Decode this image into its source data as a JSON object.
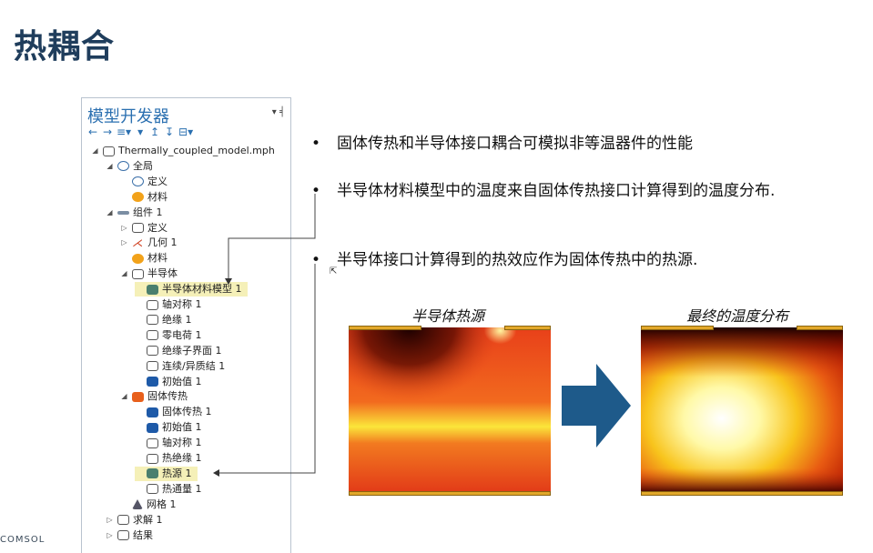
{
  "slide": {
    "title": "热耦合",
    "logo": "COMSOL"
  },
  "panel": {
    "header": "模型开发器",
    "header_controls": "▾ ╡",
    "toolbar": [
      "←",
      "→",
      "≡▾",
      "▾",
      "↥",
      "↧",
      "⊟▾"
    ]
  },
  "tree": [
    {
      "indent": 0,
      "exp": "◢",
      "icon": "model",
      "label": "Thermally_coupled_model.mph"
    },
    {
      "indent": 1,
      "exp": "◢",
      "icon": "globe",
      "label": "全局"
    },
    {
      "indent": 2,
      "exp": "",
      "icon": "def",
      "label": "定义"
    },
    {
      "indent": 2,
      "exp": "",
      "icon": "mat",
      "label": "材料"
    },
    {
      "indent": 1,
      "exp": "◢",
      "icon": "comp",
      "label": "组件 1"
    },
    {
      "indent": 2,
      "exp": "▷",
      "icon": "def-list",
      "label": "定义"
    },
    {
      "indent": 2,
      "exp": "▷",
      "icon": "geo",
      "label": "几何 1"
    },
    {
      "indent": 2,
      "exp": "",
      "icon": "mat",
      "label": "材料"
    },
    {
      "indent": 2,
      "exp": "◢",
      "icon": "semi",
      "label": "半导体"
    },
    {
      "indent": 3,
      "exp": "",
      "icon": "teal",
      "label": "半导体材料模型 1",
      "highlight": true
    },
    {
      "indent": 3,
      "exp": "",
      "icon": "outline",
      "label": "轴对称 1"
    },
    {
      "indent": 3,
      "exp": "",
      "icon": "outline",
      "label": "绝缘 1"
    },
    {
      "indent": 3,
      "exp": "",
      "icon": "outline",
      "label": "零电荷 1"
    },
    {
      "indent": 3,
      "exp": "",
      "icon": "outline",
      "label": "绝缘子界面 1"
    },
    {
      "indent": 3,
      "exp": "",
      "icon": "outline",
      "label": "连续/异质结 1"
    },
    {
      "indent": 3,
      "exp": "",
      "icon": "blue",
      "label": "初始值 1"
    },
    {
      "indent": 2,
      "exp": "◢",
      "icon": "heat",
      "label": "固体传热"
    },
    {
      "indent": 3,
      "exp": "",
      "icon": "blue",
      "label": "固体传热 1"
    },
    {
      "indent": 3,
      "exp": "",
      "icon": "blue",
      "label": "初始值 1"
    },
    {
      "indent": 3,
      "exp": "",
      "icon": "outline",
      "label": "轴对称 1"
    },
    {
      "indent": 3,
      "exp": "",
      "icon": "outline",
      "label": "热绝缘 1"
    },
    {
      "indent": 3,
      "exp": "",
      "icon": "teal",
      "label": "热源 1",
      "highlight": true
    },
    {
      "indent": 3,
      "exp": "",
      "icon": "outline",
      "label": "热通量 1"
    },
    {
      "indent": 2,
      "exp": "",
      "icon": "mesh",
      "label": "网格 1"
    },
    {
      "indent": 1,
      "exp": "▷",
      "icon": "study",
      "label": "求解 1"
    },
    {
      "indent": 1,
      "exp": "▷",
      "icon": "results",
      "label": "结果"
    }
  ],
  "bullets": [
    {
      "dot": "•",
      "text": "固体传热和半导体接口耦合可模拟非等温器件的性能"
    },
    {
      "dot": "•",
      "text": "半导体材料模型中的温度来自固体传热接口计算得到的温度分布."
    },
    {
      "dot": "•",
      "text": "半导体接口计算得到的热效应作为固体传热中的热源."
    }
  ],
  "figures": {
    "left_caption": "半导体热源",
    "right_caption": "最终的温度分布",
    "arrow_color": "#1e5a8a",
    "contact_color": "#e2a82a"
  }
}
